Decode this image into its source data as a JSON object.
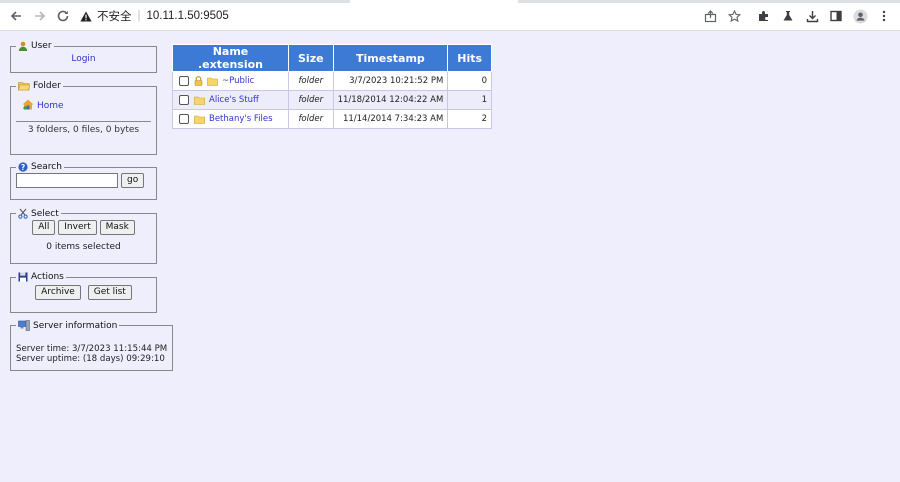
{
  "browser": {
    "security_label": "不安全",
    "url": "10.11.1.50:9505"
  },
  "panels": {
    "user": {
      "title": "User",
      "login_label": "Login"
    },
    "folder": {
      "title": "Folder",
      "home_label": "Home",
      "summary": "3 folders, 0 files, 0 bytes"
    },
    "search": {
      "title": "Search",
      "input_value": "",
      "go_label": "go"
    },
    "select": {
      "title": "Select",
      "all_label": "All",
      "invert_label": "Invert",
      "mask_label": "Mask",
      "status": "0 items selected"
    },
    "actions": {
      "title": "Actions",
      "archive_label": "Archive",
      "getlist_label": "Get list"
    },
    "server": {
      "title": "Server information",
      "time": "Server time: 3/7/2023 11:15:44 PM",
      "uptime": "Server uptime: (18 days) 09:29:10"
    }
  },
  "table": {
    "headers": {
      "name": "Name .extension",
      "size": "Size",
      "timestamp": "Timestamp",
      "hits": "Hits"
    },
    "rows": [
      {
        "name": "~Public",
        "size": "folder",
        "timestamp": "3/7/2023 10:21:52 PM",
        "hits": "0",
        "locked": true
      },
      {
        "name": "Alice's Stuff",
        "size": "folder",
        "timestamp": "11/18/2014 12:04:22 AM",
        "hits": "1",
        "locked": false
      },
      {
        "name": "Bethany's Files",
        "size": "folder",
        "timestamp": "11/14/2014 7:34:23 AM",
        "hits": "2",
        "locked": false
      }
    ]
  },
  "colors": {
    "header_bg": "#3d7ad6",
    "page_bg": "#eeeefc",
    "link": "#3333cc"
  }
}
